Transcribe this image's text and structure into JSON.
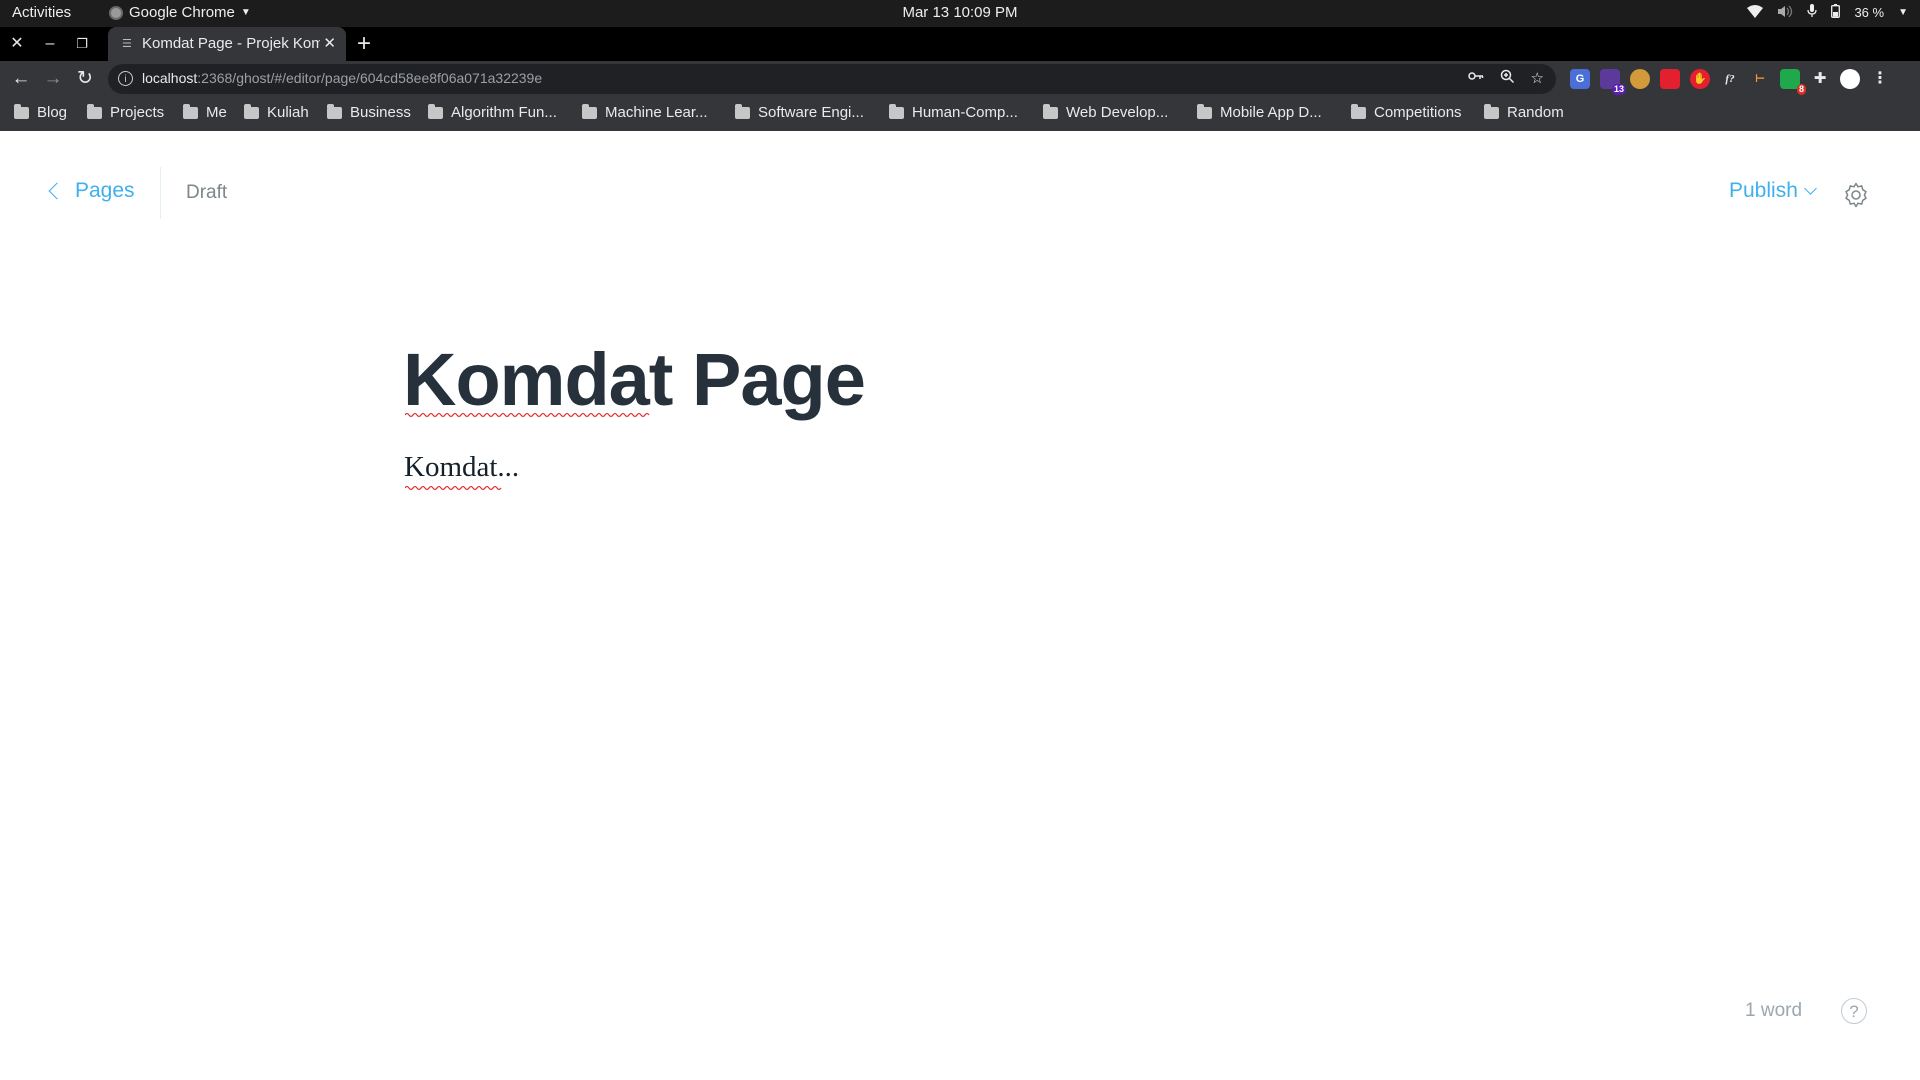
{
  "os_bar": {
    "activities": "Activities",
    "app_name": "Google Chrome",
    "clock": "Mar 13  10:09 PM",
    "battery": "36 %"
  },
  "browser": {
    "tab_title": "Komdat Page - Projek Kom",
    "url_host": "localhost",
    "url_rest": ":2368/ghost/#/editor/page/604cd58ee8f06a071a32239e",
    "bookmarks": [
      "Blog",
      "Projects",
      "Me",
      "Kuliah",
      "Business",
      "Algorithm Fun...",
      "Machine Lear...",
      "Software Engi...",
      "Human-Comp...",
      "Web Develop...",
      "Mobile App D...",
      "Competitions",
      "Random"
    ],
    "extension_badges": {
      "ext2": "13",
      "ext8": "8"
    },
    "colors": {
      "frame": "#000000",
      "toolbar": "#35363a",
      "omnibox": "#202124"
    }
  },
  "editor": {
    "back_label": "Pages",
    "status": "Draft",
    "publish_label": "Publish",
    "title": "Komdat Page",
    "body": "Komdat...",
    "word_count": "1 word",
    "help": "?",
    "colors": {
      "accent": "#3eb0ef",
      "title": "#26313b",
      "muted": "#7d878a"
    }
  }
}
